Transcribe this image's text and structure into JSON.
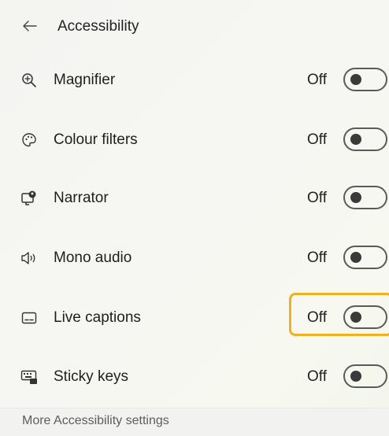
{
  "header": {
    "back_icon": "arrow-left-icon",
    "title": "Accessibility"
  },
  "items": [
    {
      "label": "Magnifier",
      "state": "Off",
      "icon": "magnifier-icon",
      "on": false
    },
    {
      "label": "Colour filters",
      "state": "Off",
      "icon": "palette-icon",
      "on": false
    },
    {
      "label": "Narrator",
      "state": "Off",
      "icon": "narrator-icon",
      "on": false
    },
    {
      "label": "Mono audio",
      "state": "Off",
      "icon": "speaker-icon",
      "on": false
    },
    {
      "label": "Live captions",
      "state": "Off",
      "icon": "captions-icon",
      "on": false,
      "highlighted": true
    },
    {
      "label": "Sticky keys",
      "state": "Off",
      "icon": "keyboard-icon",
      "on": false
    }
  ],
  "footer": {
    "more_link": "More Accessibility settings"
  },
  "colors": {
    "highlight": "#f2b01e",
    "toggle_border": "#5a5a5a",
    "toggle_knob": "#3a3a3a"
  }
}
